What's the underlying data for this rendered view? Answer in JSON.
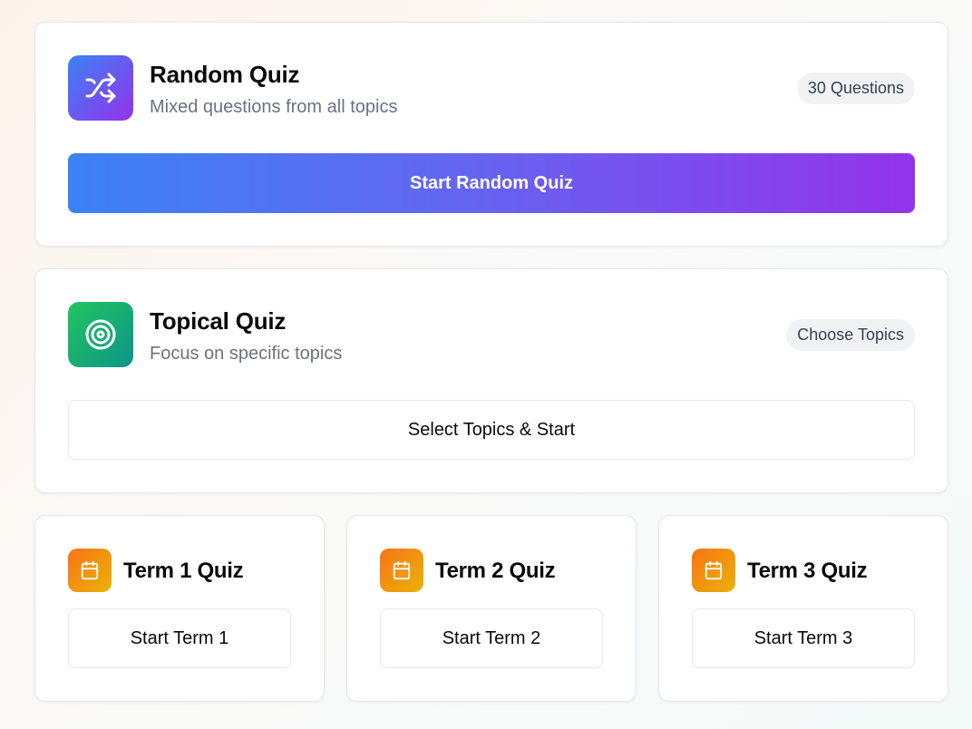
{
  "random_quiz": {
    "title": "Random Quiz",
    "subtitle": "Mixed questions from all topics",
    "badge": "30 Questions",
    "button_label": "Start Random Quiz",
    "icon": "shuffle-icon"
  },
  "topical_quiz": {
    "title": "Topical Quiz",
    "subtitle": "Focus on specific topics",
    "badge": "Choose Topics",
    "button_label": "Select Topics & Start",
    "icon": "target-icon"
  },
  "term_quizzes": [
    {
      "title": "Term 1 Quiz",
      "button_label": "Start Term 1",
      "icon": "calendar-icon"
    },
    {
      "title": "Term 2 Quiz",
      "button_label": "Start Term 2",
      "icon": "calendar-icon"
    },
    {
      "title": "Term 3 Quiz",
      "button_label": "Start Term 3",
      "icon": "calendar-icon"
    }
  ],
  "colors": {
    "random_gradient_start": "#3b82f6",
    "random_gradient_end": "#9333ea",
    "topical_gradient_start": "#22c55e",
    "topical_gradient_end": "#0d9488",
    "term_gradient_start": "#f97316",
    "term_gradient_end": "#eab308"
  }
}
